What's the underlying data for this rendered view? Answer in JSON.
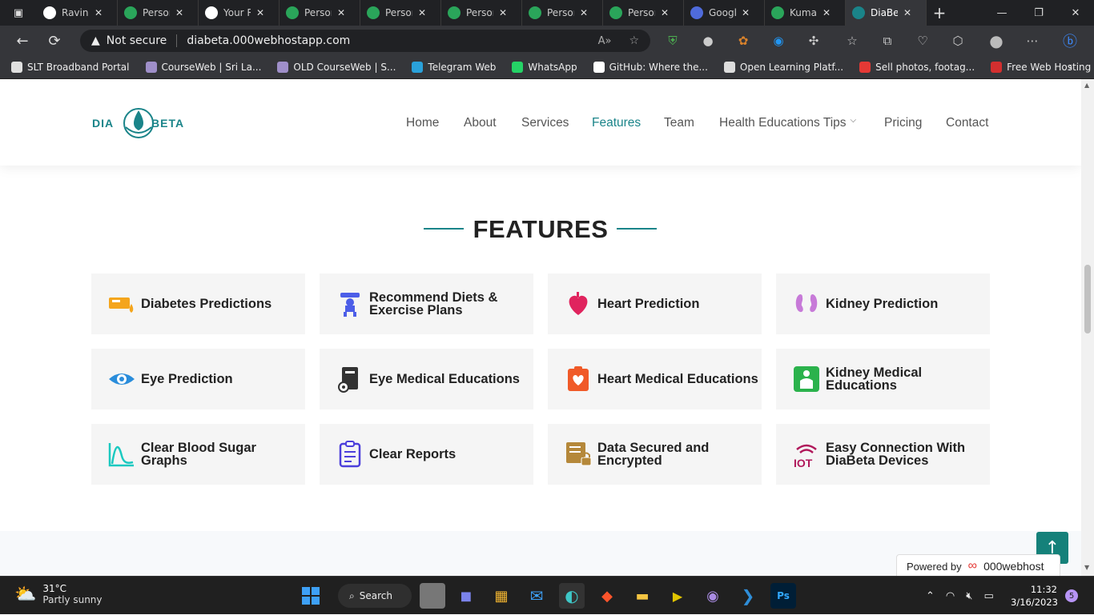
{
  "browser": {
    "tabs": [
      {
        "label": "Ravind",
        "icon": "github-icon",
        "color": "#ffffff"
      },
      {
        "label": "Person",
        "icon": "site-icon",
        "color": "#2aa55a"
      },
      {
        "label": "Your R",
        "icon": "github-icon",
        "color": "#ffffff"
      },
      {
        "label": "Person",
        "icon": "site-icon",
        "color": "#2aa55a"
      },
      {
        "label": "Person",
        "icon": "site-icon",
        "color": "#2aa55a"
      },
      {
        "label": "Person",
        "icon": "site-icon",
        "color": "#2aa55a"
      },
      {
        "label": "Person",
        "icon": "site-icon",
        "color": "#2aa55a"
      },
      {
        "label": "Person",
        "icon": "site-icon",
        "color": "#2aa55a"
      },
      {
        "label": "Googl",
        "icon": "google-icon",
        "color": "#4f6bdb"
      },
      {
        "label": "Kumar",
        "icon": "site-icon",
        "color": "#2aa55a"
      },
      {
        "label": "DiaBet",
        "icon": "diabeta-icon",
        "color": "#1a8489"
      }
    ],
    "security_label": "Not secure",
    "url": "diabeta.000webhostapp.com",
    "bookmarks": [
      {
        "label": "SLT Broadband Portal",
        "color": "#e0e0e0"
      },
      {
        "label": "CourseWeb | Sri La...",
        "color": "#9f8fc9"
      },
      {
        "label": "OLD CourseWeb | S...",
        "color": "#9f8fc9"
      },
      {
        "label": "Telegram Web",
        "color": "#2aa1da"
      },
      {
        "label": "WhatsApp",
        "color": "#25d366"
      },
      {
        "label": "GitHub: Where the...",
        "color": "#ffffff"
      },
      {
        "label": "Open Learning Platf...",
        "color": "#dddddd"
      },
      {
        "label": "Sell photos, footag...",
        "color": "#e53935"
      },
      {
        "label": "Free Web Hosting -...",
        "color": "#d32f2f"
      }
    ]
  },
  "site": {
    "logo_text": "DIA BETA",
    "nav": [
      "Home",
      "About",
      "Services",
      "Features",
      "Team",
      "Health Educations Tips",
      "Pricing",
      "Contact"
    ],
    "active_nav": "Features",
    "accent": "#1a8489",
    "features_title": "FEATURES",
    "features": [
      {
        "label": "Diabetes Predictions",
        "icon": "glucose-meter-icon",
        "color": "#f4a51c"
      },
      {
        "label": "Recommend Diets & Exercise Plans",
        "icon": "fitness-icon",
        "color": "#4c5ee8"
      },
      {
        "label": "Heart Prediction",
        "icon": "heart-organ-icon",
        "color": "#e0245e"
      },
      {
        "label": "Kidney Prediction",
        "icon": "kidney-icon",
        "color": "#c77ad8"
      },
      {
        "label": "Eye Prediction",
        "icon": "eye-icon",
        "color": "#2a8ddb"
      },
      {
        "label": "Eye Medical Educations",
        "icon": "eye-book-icon",
        "color": "#333333"
      },
      {
        "label": "Heart Medical Educations",
        "icon": "heart-clipboard-icon",
        "color": "#f05a28"
      },
      {
        "label": "Kidney Medical Educations",
        "icon": "body-scan-icon",
        "color": "#2bb24c"
      },
      {
        "label": "Clear Blood Sugar Graphs",
        "icon": "graph-icon",
        "color": "#1bc9c0"
      },
      {
        "label": "Clear Reports",
        "icon": "report-icon",
        "color": "#4c3fdb"
      },
      {
        "label": "Data Secured and Encrypted",
        "icon": "secure-data-icon",
        "color": "#b5883a"
      },
      {
        "label": "Easy Connection With DiaBeta Devices",
        "icon": "iot-icon",
        "color": "#b0185a"
      }
    ],
    "powered_by": "Powered by",
    "host_name": "000webhost"
  },
  "taskbar": {
    "temperature": "31°C",
    "weather": "Partly sunny",
    "search_label": "Search",
    "time": "11:32",
    "date": "3/16/2023",
    "notification_count": "5"
  }
}
